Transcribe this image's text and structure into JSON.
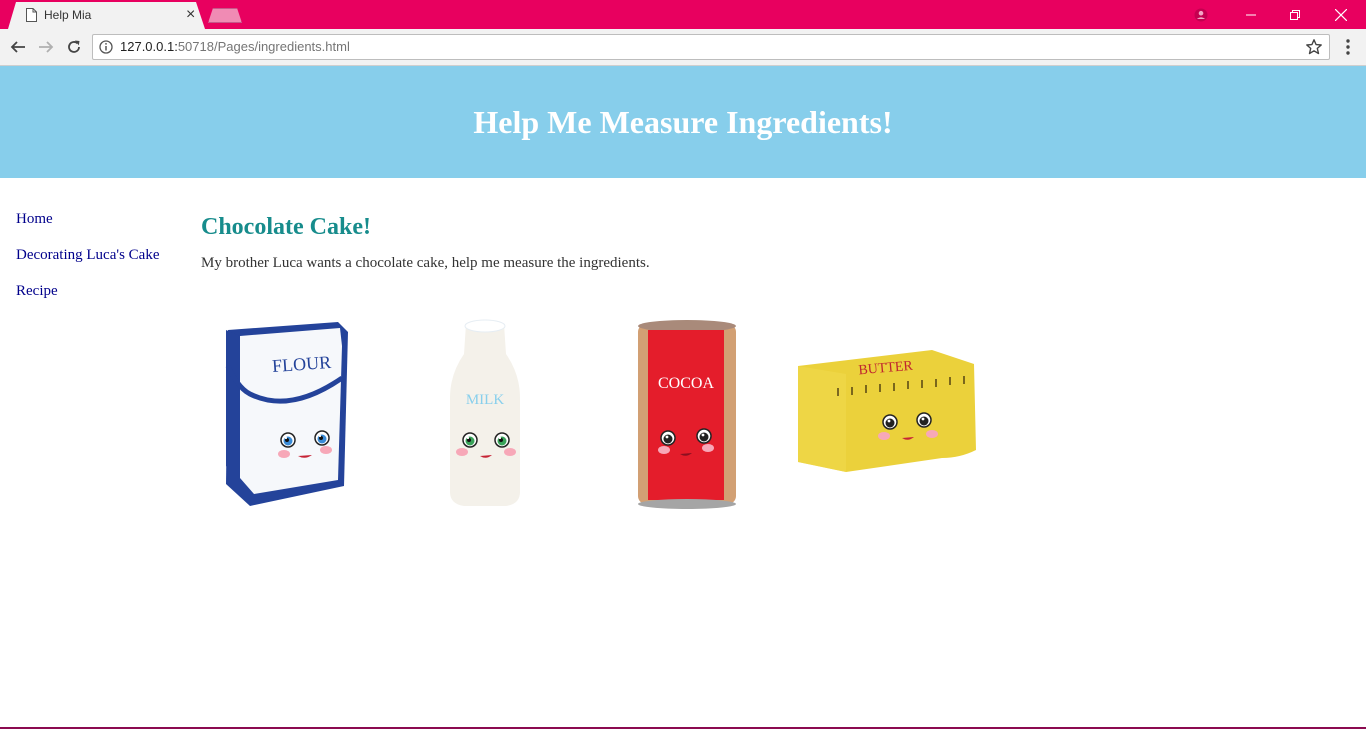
{
  "browser": {
    "tab_title": "Help Mia",
    "url_host": "127.0.0.1:",
    "url_rest": "50718/Pages/ingredients.html"
  },
  "header": {
    "title": "Help Me Measure Ingredients!"
  },
  "sidebar": {
    "items": [
      {
        "label": "Home"
      },
      {
        "label": "Decorating Luca's Cake"
      },
      {
        "label": "Recipe"
      }
    ]
  },
  "main": {
    "heading": "Chocolate Cake!",
    "intro": "My brother Luca wants a chocolate cake, help me measure the ingredients.",
    "ingredients": [
      {
        "label": "FLOUR",
        "icon": "flour-bag-icon"
      },
      {
        "label": "MILK",
        "icon": "milk-bottle-icon"
      },
      {
        "label": "COCOA",
        "icon": "cocoa-can-icon"
      },
      {
        "label": "BUTTER",
        "icon": "butter-block-icon"
      }
    ]
  },
  "colors": {
    "titlebar": "#e8005f",
    "header_bg": "#87ceeb",
    "heading": "#178c8c",
    "link": "#00008b"
  }
}
